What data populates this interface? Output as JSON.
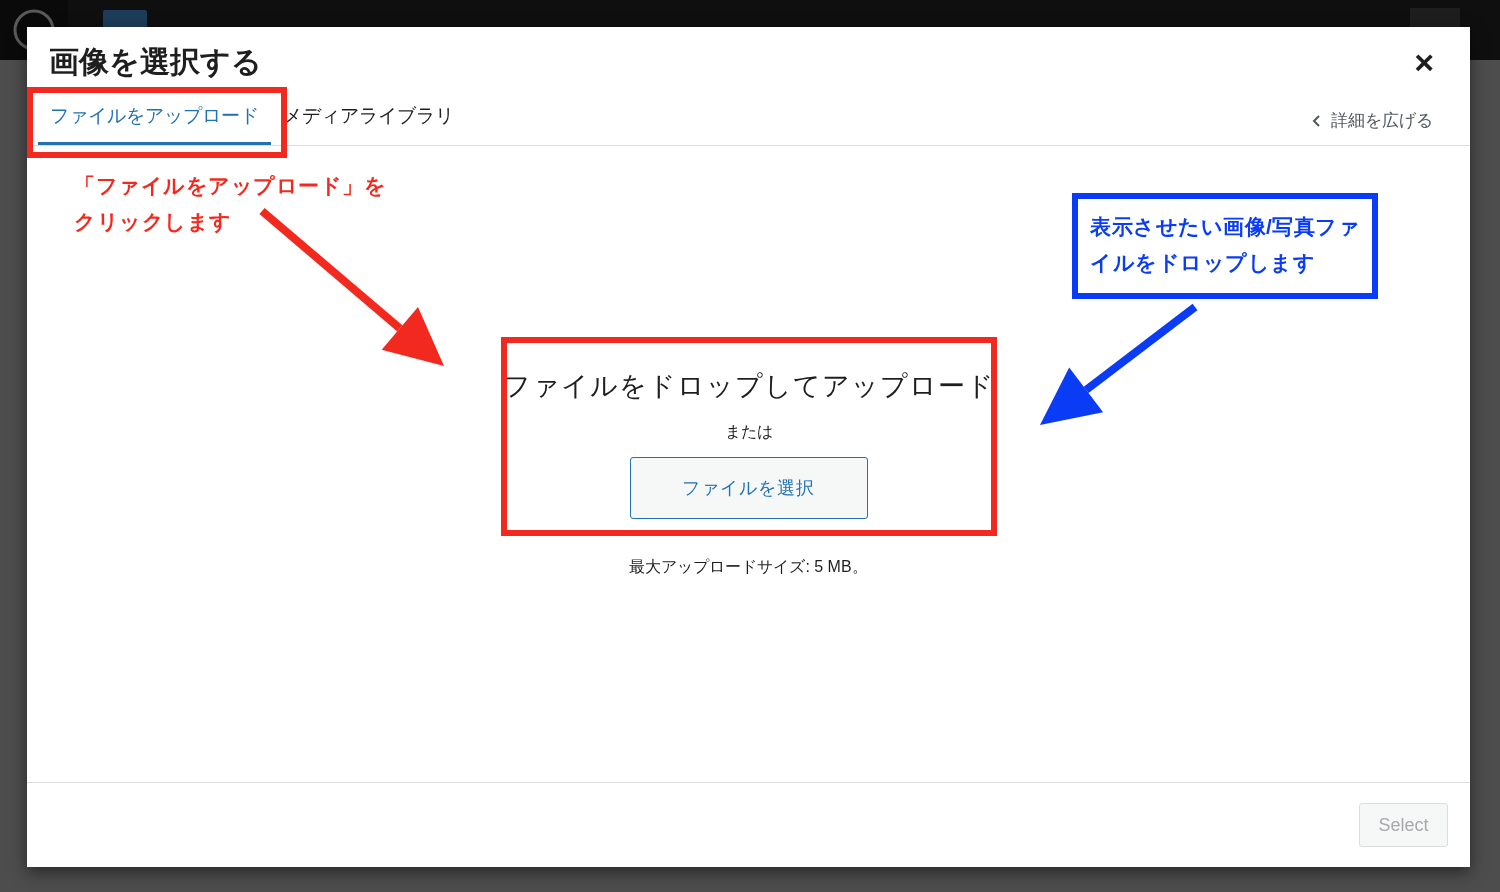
{
  "modal": {
    "title": "画像を選択する",
    "close": "×",
    "tabs": [
      {
        "label": "ファイルをアップロード",
        "selected": true
      },
      {
        "label": "メディアライブラリ",
        "selected": false
      }
    ],
    "expand_details": "詳細を広げる",
    "upload": {
      "heading": "ファイルをドロップしてアップロード",
      "or": "または",
      "button": "ファイルを選択",
      "max_size": "最大アップロードサイズ: 5 MB。"
    },
    "select_button": {
      "label": "Select",
      "disabled": true
    }
  },
  "annotations": [
    {
      "kind": "box",
      "color": "#f2291f"
    },
    {
      "kind": "box",
      "color": "#f2291f"
    },
    {
      "kind": "callout",
      "lines": [
        "「ファイルをアップロード」を",
        "クリックします"
      ],
      "color": "#f2291f",
      "framed": false
    },
    {
      "kind": "callout",
      "lines": [
        "表示させたい画像/写真ファ",
        "イルをドロップします"
      ],
      "color": "#0a3cf5",
      "framed": true
    },
    {
      "kind": "arrow",
      "color": "#f2291f"
    },
    {
      "kind": "arrow",
      "color": "#0a3cf5"
    }
  ]
}
